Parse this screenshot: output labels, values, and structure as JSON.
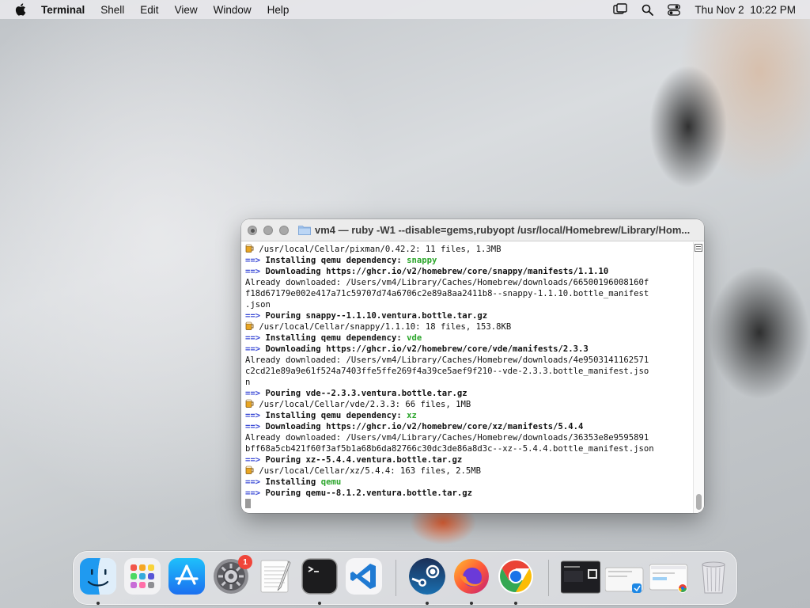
{
  "menubar": {
    "app_name": "Terminal",
    "items": [
      "Shell",
      "Edit",
      "View",
      "Window",
      "Help"
    ],
    "date": "Thu Nov 2",
    "time": "10:22 PM"
  },
  "window": {
    "title": "vm4 — ruby -W1 --disable=gems,rubyopt /usr/local/Homebrew/Library/Hom..."
  },
  "terminal": {
    "lines": [
      {
        "type": "beer",
        "text": " /usr/local/Cellar/pixman/0.42.2: 11 files, 1.3MB"
      },
      {
        "type": "arrow",
        "text": "Installing qemu dependency: ",
        "highlight": "snappy"
      },
      {
        "type": "arrow",
        "text": "Downloading https://ghcr.io/v2/homebrew/core/snappy/manifests/1.1.10"
      },
      {
        "type": "plain",
        "text": "Already downloaded: /Users/vm4/Library/Caches/Homebrew/downloads/66500196008160f"
      },
      {
        "type": "plain",
        "text": "f18d67179e002e417a71c59707d74a6706c2e89a8aa2411b8--snappy-1.1.10.bottle_manifest"
      },
      {
        "type": "plain",
        "text": ".json"
      },
      {
        "type": "arrow",
        "text": "Pouring snappy--1.1.10.ventura.bottle.tar.gz"
      },
      {
        "type": "beer",
        "text": " /usr/local/Cellar/snappy/1.1.10: 18 files, 153.8KB"
      },
      {
        "type": "arrow",
        "text": "Installing qemu dependency: ",
        "highlight": "vde"
      },
      {
        "type": "arrow",
        "text": "Downloading https://ghcr.io/v2/homebrew/core/vde/manifests/2.3.3"
      },
      {
        "type": "plain",
        "text": "Already downloaded: /Users/vm4/Library/Caches/Homebrew/downloads/4e9503141162571"
      },
      {
        "type": "plain",
        "text": "c2cd21e89a9e61f524a7403ffe5ffe269f4a39ce5aef9f210--vde-2.3.3.bottle_manifest.jso"
      },
      {
        "type": "plain",
        "text": "n"
      },
      {
        "type": "arrow",
        "text": "Pouring vde--2.3.3.ventura.bottle.tar.gz"
      },
      {
        "type": "beer",
        "text": " /usr/local/Cellar/vde/2.3.3: 66 files, 1MB"
      },
      {
        "type": "arrow",
        "text": "Installing qemu dependency: ",
        "highlight": "xz"
      },
      {
        "type": "arrow",
        "text": "Downloading https://ghcr.io/v2/homebrew/core/xz/manifests/5.4.4"
      },
      {
        "type": "plain",
        "text": "Already downloaded: /Users/vm4/Library/Caches/Homebrew/downloads/36353e8e9595891"
      },
      {
        "type": "plain",
        "text": "bff68a5cb421f60f3af5b1a68b6da82766c30dc3de86a8d3c--xz--5.4.4.bottle_manifest.json"
      },
      {
        "type": "arrow",
        "text": "Pouring xz--5.4.4.ventura.bottle.tar.gz"
      },
      {
        "type": "beer",
        "text": " /usr/local/Cellar/xz/5.4.4: 163 files, 2.5MB"
      },
      {
        "type": "arrow",
        "text": "Installing ",
        "highlight": "qemu"
      },
      {
        "type": "arrow",
        "text": "Pouring qemu--8.1.2.ventura.bottle.tar.gz"
      }
    ],
    "arrow_glyph": "==>"
  },
  "dock": {
    "apps": [
      {
        "name": "Finder",
        "icon": "finder-icon",
        "running": true
      },
      {
        "name": "Launchpad",
        "icon": "launchpad-icon",
        "running": false
      },
      {
        "name": "App Store",
        "icon": "app-store-icon",
        "running": false
      },
      {
        "name": "System Settings",
        "icon": "system-settings-icon",
        "running": false,
        "badge": "1"
      },
      {
        "name": "TextEdit",
        "icon": "textedit-icon",
        "running": false
      },
      {
        "name": "Terminal",
        "icon": "terminal-icon",
        "running": true
      },
      {
        "name": "Visual Studio Code",
        "icon": "vscode-icon",
        "running": false
      },
      {
        "name": "Steam",
        "icon": "steam-icon",
        "running": true
      },
      {
        "name": "Firefox",
        "icon": "firefox-icon",
        "running": true
      },
      {
        "name": "Chrome",
        "icon": "chrome-icon",
        "running": true
      }
    ],
    "system_settings_badge": "1",
    "colors": {
      "arrow": "#3b4bd6",
      "highlight": "#2aa52a",
      "badge": "#f0453a"
    }
  }
}
